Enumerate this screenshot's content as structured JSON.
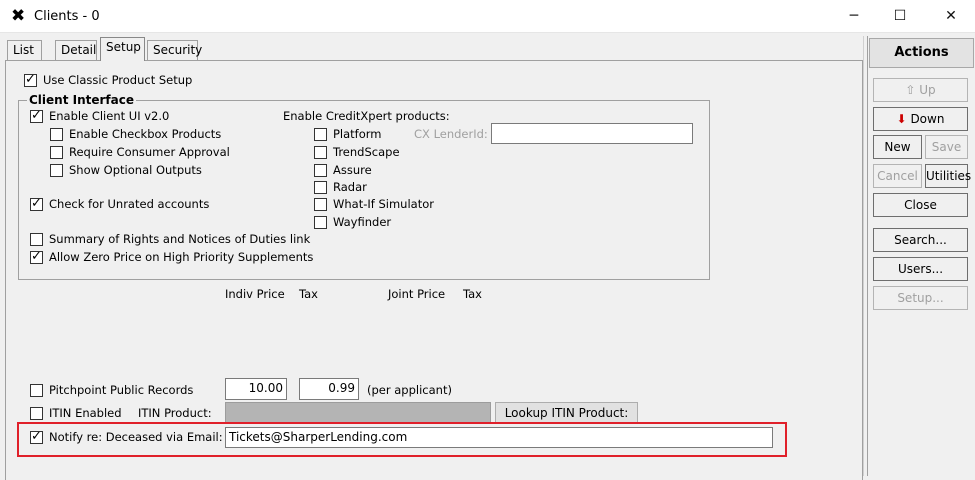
{
  "window": {
    "title": "Clients - 0",
    "app_icon_glyph": "✖",
    "minimize_glyph": "─",
    "maximize_glyph": "☐",
    "close_glyph": "✕"
  },
  "tabs": [
    {
      "label": "List",
      "active": false
    },
    {
      "label": "Detail",
      "active": false
    },
    {
      "label": "Setup",
      "active": true
    },
    {
      "label": "Security",
      "active": false
    }
  ],
  "setup": {
    "use_classic_product_setup": {
      "label": "Use Classic Product Setup",
      "checked": true
    },
    "client_interface": {
      "title": "Client Interface",
      "enable_client_ui": {
        "label": "Enable Client UI v2.0",
        "checked": true
      },
      "enable_checkbox_products": {
        "label": "Enable Checkbox Products",
        "checked": false
      },
      "require_consumer_approval": {
        "label": "Require Consumer Approval",
        "checked": false
      },
      "show_optional_outputs": {
        "label": "Show Optional Outputs",
        "checked": false
      },
      "check_unrated_accounts": {
        "label": "Check for Unrated accounts",
        "checked": true
      },
      "summary_of_rights": {
        "label": "Summary of Rights and Notices of Duties link",
        "checked": false
      },
      "allow_zero_price": {
        "label": "Allow Zero Price on High Priority Supplements",
        "checked": true
      },
      "creditxpert_heading": "Enable CreditXpert products:",
      "creditxpert_products": [
        {
          "label": "Platform",
          "checked": false
        },
        {
          "label": "TrendScape",
          "checked": false
        },
        {
          "label": "Assure",
          "checked": false
        },
        {
          "label": "Radar",
          "checked": false
        },
        {
          "label": "What-If Simulator",
          "checked": false
        },
        {
          "label": "Wayfinder",
          "checked": false
        }
      ],
      "cx_lender_id_label": "CX LenderId:",
      "cx_lender_id_value": ""
    },
    "price_headers": {
      "indiv_price": "Indiv Price",
      "tax1": "Tax",
      "joint_price": "Joint Price",
      "tax2": "Tax"
    },
    "pitchpoint": {
      "label": "Pitchpoint Public Records",
      "checked": false,
      "indiv_price": "10.00",
      "tax": "0.99",
      "note": "(per applicant)"
    },
    "itin": {
      "label": "ITIN Enabled",
      "checked": false,
      "product_label": "ITIN Product:",
      "product_value": "",
      "lookup_button": "Lookup ITIN Product:"
    },
    "notify_deceased": {
      "label": "Notify re: Deceased via Email:",
      "checked": true,
      "email": "Tickets@SharperLending.com"
    }
  },
  "actions": {
    "header": "Actions",
    "up": "Up",
    "down": "Down",
    "new": "New",
    "save": "Save",
    "cancel": "Cancel",
    "utilities": "Utilities",
    "close": "Close",
    "search": "Search...",
    "users": "Users...",
    "setup": "Setup..."
  },
  "colors": {
    "highlight_border": "#e0202a",
    "down_arrow": "#cc0000",
    "up_arrow_disabled": "#a0a0a0"
  }
}
